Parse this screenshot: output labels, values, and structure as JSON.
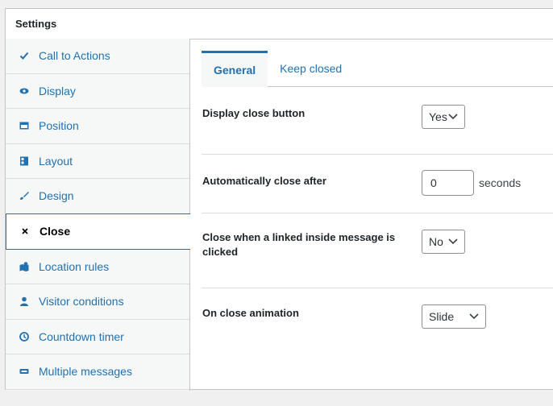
{
  "header": {
    "title": "Settings"
  },
  "sidebar": {
    "items": [
      {
        "label": "Call to Actions",
        "icon": "checkmark-icon"
      },
      {
        "label": "Display",
        "icon": "eye-icon"
      },
      {
        "label": "Position",
        "icon": "position-icon"
      },
      {
        "label": "Layout",
        "icon": "layout-icon"
      },
      {
        "label": "Design",
        "icon": "brush-icon"
      },
      {
        "label": "Close",
        "icon": "close-icon",
        "active": true
      },
      {
        "label": "Location rules",
        "icon": "location-icon"
      },
      {
        "label": "Visitor conditions",
        "icon": "user-icon"
      },
      {
        "label": "Countdown timer",
        "icon": "clock-icon"
      },
      {
        "label": "Multiple messages",
        "icon": "messages-icon"
      }
    ]
  },
  "tabs": [
    {
      "label": "General",
      "active": true
    },
    {
      "label": "Keep closed",
      "active": false
    }
  ],
  "fields": {
    "display_close_button": {
      "label": "Display close button",
      "value": "Yes"
    },
    "auto_close": {
      "label": "Automatically close after",
      "value": "0",
      "unit": "seconds"
    },
    "close_linked": {
      "label": "Close when a linked inside message is clicked",
      "value": "No"
    },
    "close_animation": {
      "label": "On close animation",
      "value": "Slide"
    }
  },
  "colors": {
    "accent": "#2271b1",
    "border": "#c3c4c7",
    "background": "#f0f0f1"
  }
}
